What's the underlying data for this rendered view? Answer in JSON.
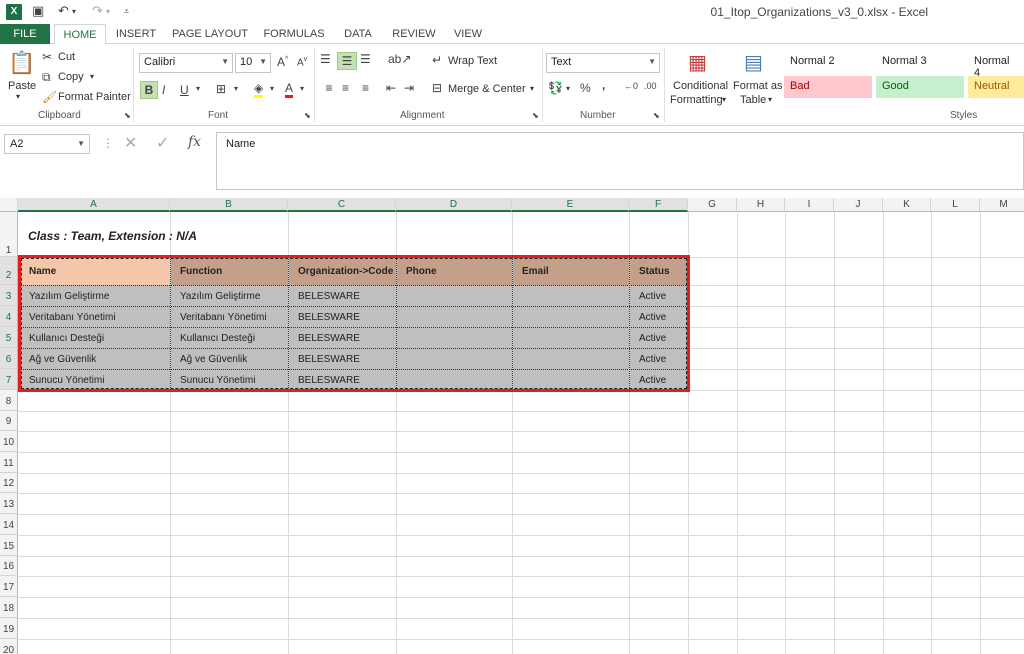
{
  "window": {
    "title": "01_Itop_Organizations_v3_0.xlsx - Excel",
    "app_icon": "X"
  },
  "ribbon": {
    "tabs": [
      "FILE",
      "HOME",
      "INSERT",
      "PAGE LAYOUT",
      "FORMULAS",
      "DATA",
      "REVIEW",
      "VIEW"
    ],
    "active_tab": "HOME",
    "clipboard": {
      "paste": "Paste",
      "cut": "Cut",
      "copy": "Copy",
      "format_painter": "Format Painter",
      "label": "Clipboard"
    },
    "font": {
      "family": "Calibri",
      "size": "10",
      "bold": "B",
      "italic": "I",
      "underline": "U",
      "label": "Font"
    },
    "alignment": {
      "wrap_text": "Wrap Text",
      "merge_center": "Merge & Center",
      "label": "Alignment"
    },
    "number": {
      "format": "Text",
      "percent": "%",
      "comma": ",",
      "label": "Number"
    },
    "styles": {
      "conditional_formatting": "Conditional Formatting",
      "conditional_line1": "Conditional",
      "conditional_line2": "Formatting",
      "format_as_table_line1": "Format as",
      "format_as_table_line2": "Table",
      "normal2": "Normal 2",
      "normal3": "Normal 3",
      "normal4": "Normal 4",
      "bad": "Bad",
      "good": "Good",
      "neutral": "Neutral",
      "label": "Styles"
    }
  },
  "formula_bar": {
    "name_box": "A2",
    "formula": "Name"
  },
  "sheet": {
    "columns": [
      "A",
      "B",
      "C",
      "D",
      "E",
      "F",
      "G",
      "H",
      "I",
      "J",
      "K",
      "L",
      "M"
    ],
    "rows": [
      "1",
      "2",
      "3",
      "4",
      "5",
      "6",
      "7",
      "8",
      "9",
      "10",
      "11",
      "12",
      "13",
      "14",
      "15",
      "16",
      "17",
      "18",
      "19",
      "20"
    ],
    "title": "Class : Team,  Extension : N/A",
    "headers": [
      "Name",
      "Function",
      "Organization->Code",
      "Phone",
      "Email",
      "Status"
    ],
    "data": [
      [
        "Yazılım Geliştirme",
        "Yazılım Geliştirme",
        "BELESWARE",
        "",
        "",
        "Active"
      ],
      [
        "Veritabanı Yönetimi",
        "Veritabanı Yönetimi",
        "BELESWARE",
        "",
        "",
        "Active"
      ],
      [
        "Kullanıcı Desteği",
        "Kullanıcı Desteği",
        "BELESWARE",
        "",
        "",
        "Active"
      ],
      [
        "Ağ ve Güvenlik",
        "Ağ ve Güvenlik",
        "BELESWARE",
        "",
        "",
        "Active"
      ],
      [
        "Sunucu Yönetimi",
        "Sunucu Yönetimi",
        "BELESWARE",
        "",
        "",
        "Active"
      ]
    ]
  },
  "colors": {
    "excel_green": "#217346",
    "header_fill_a": "#f4c6aa",
    "header_fill": "#c4a08a",
    "data_fill": "#bfbfbf",
    "highlight_border": "#e02020"
  }
}
